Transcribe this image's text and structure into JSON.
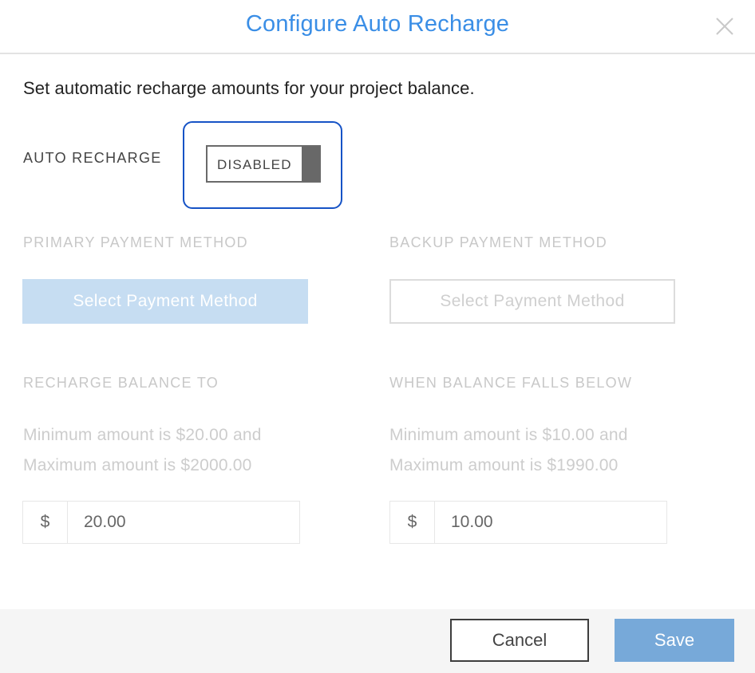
{
  "dialog": {
    "title": "Configure Auto Recharge",
    "intro": "Set automatic recharge amounts for your project balance."
  },
  "auto_recharge": {
    "label": "AUTO RECHARGE",
    "toggle_text": "DISABLED",
    "enabled": false
  },
  "payment": {
    "primary_label": "PRIMARY PAYMENT METHOD",
    "primary_button": "Select Payment Method",
    "backup_label": "BACKUP PAYMENT METHOD",
    "backup_button": "Select Payment Method"
  },
  "recharge_to": {
    "label": "RECHARGE BALANCE TO",
    "hint_line1": "Minimum amount is $20.00 and",
    "hint_line2": "Maximum amount is $2000.00",
    "prefix": "$",
    "value": "20.00"
  },
  "falls_below": {
    "label": "WHEN BALANCE FALLS BELOW",
    "hint_line1": "Minimum amount is $10.00 and",
    "hint_line2": "Maximum amount is $1990.00",
    "prefix": "$",
    "value": "10.00"
  },
  "footer": {
    "cancel_label": "Cancel",
    "save_label": "Save"
  },
  "icons": {
    "close": "close-icon"
  },
  "colors": {
    "accent": "#3a8ee6",
    "focus": "#1653c6",
    "primary_button_disabled": "#c6ddf2",
    "save_button": "#77a9d9"
  }
}
